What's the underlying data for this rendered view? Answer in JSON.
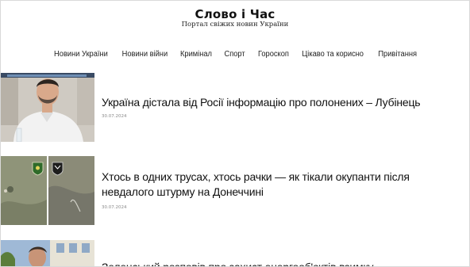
{
  "site": {
    "title": "Слово і Час",
    "tagline": "Портал свіжих новин України"
  },
  "nav": {
    "items": [
      {
        "label": "Новини України"
      },
      {
        "label": "Новини війни"
      },
      {
        "label": "Кримінал"
      },
      {
        "label": "Спорт"
      },
      {
        "label": "Гороскоп"
      },
      {
        "label": "Цікаво та корисно"
      },
      {
        "label": "Привітання"
      }
    ]
  },
  "articles": [
    {
      "title": "Україна дістала від Росії інформацію про полонених – Лубінець",
      "date": "30.07.2024",
      "image_icon": "portrait-photo"
    },
    {
      "title": "Хтось в одних трусах, хтось рачки — як тікали окупанти після невдалого штурму на Донеччині",
      "date": "30.07.2024",
      "image_icon": "battlefield-drone-photo"
    },
    {
      "title": "Зеленський розповів про захист енергооб'єктів взимку",
      "date": "",
      "image_icon": "portrait-photo"
    }
  ]
}
